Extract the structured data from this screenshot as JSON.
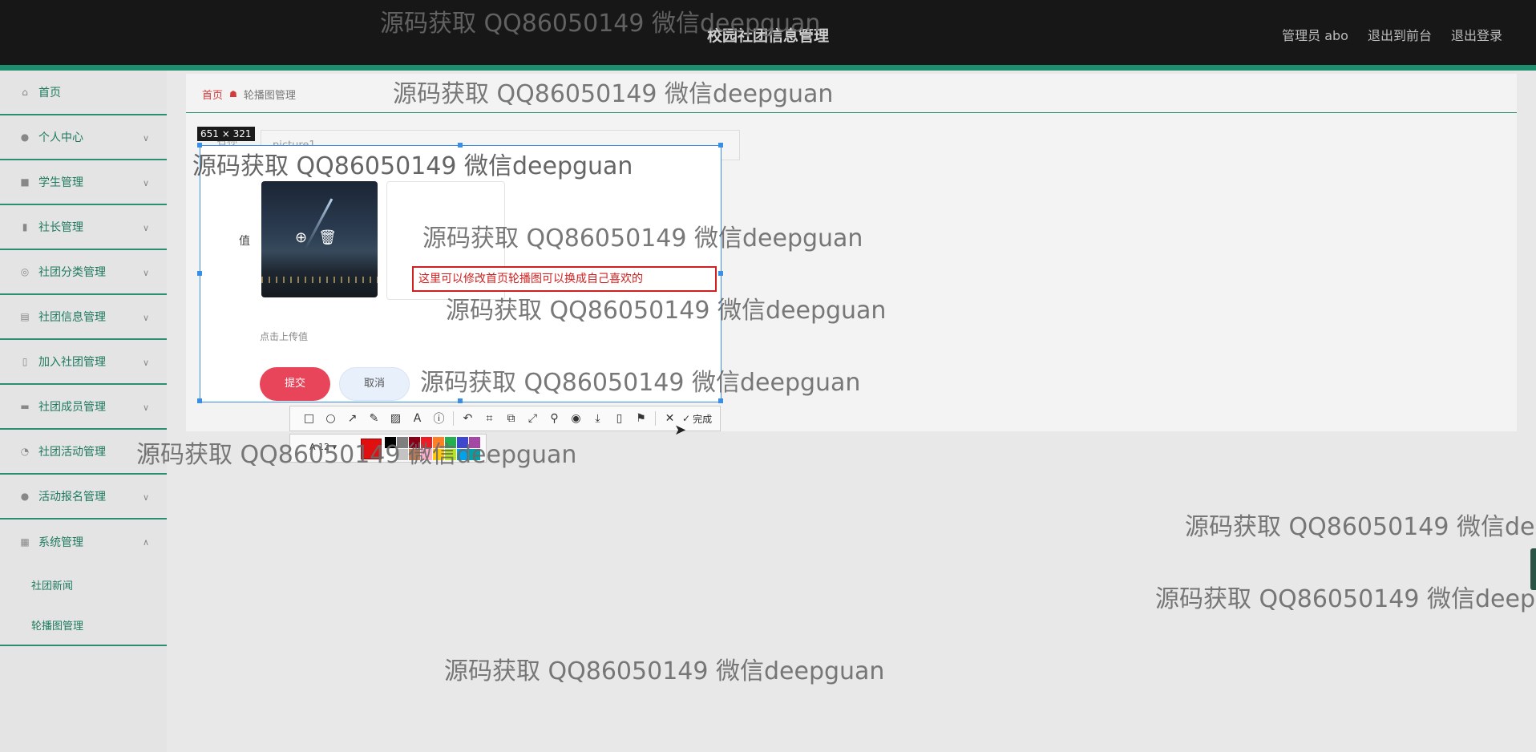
{
  "header": {
    "title": "校园社团信息管理",
    "links": [
      "管理员 abo",
      "退出到前台",
      "退出登录"
    ]
  },
  "sidebar": {
    "items": [
      {
        "label": "首页",
        "icon": "home-icon",
        "expandable": false
      },
      {
        "label": "个人中心",
        "icon": "user-icon",
        "expandable": true
      },
      {
        "label": "学生管理",
        "icon": "briefcase-icon",
        "expandable": true
      },
      {
        "label": "社长管理",
        "icon": "microphone-icon",
        "expandable": true
      },
      {
        "label": "社团分类管理",
        "icon": "target-icon",
        "expandable": true
      },
      {
        "label": "社团信息管理",
        "icon": "clipboard-icon",
        "expandable": true
      },
      {
        "label": "加入社团管理",
        "icon": "phone-icon",
        "expandable": true
      },
      {
        "label": "社团成员管理",
        "icon": "chat-icon",
        "expandable": true
      },
      {
        "label": "社团活动管理",
        "icon": "gauge-icon",
        "expandable": true
      },
      {
        "label": "活动报名管理",
        "icon": "leaf-icon",
        "expandable": true
      },
      {
        "label": "系统管理",
        "icon": "chart-icon",
        "expandable": true,
        "expanded": true
      }
    ],
    "sub_items": [
      "社团新闻",
      "轮播图管理"
    ]
  },
  "breadcrumb": {
    "home": "首页",
    "current": "轮播图管理"
  },
  "form": {
    "name_label": "名称",
    "name_value": "picture1",
    "value_label": "值",
    "upload_hint": "点击上传值",
    "submit": "提交",
    "cancel": "取消"
  },
  "annotation": {
    "tip": "这里可以修改首页轮播图可以换成自己喜欢的"
  },
  "capture": {
    "size": "651 × 321",
    "font_size": "12",
    "done": "完成",
    "selected_color": "#e01010",
    "palette": [
      "#000000",
      "#7f7f7f",
      "#880015",
      "#ed1c24",
      "#ff7f27",
      "#22b14c",
      "#3f48cc",
      "#a349a4",
      "#ffffff",
      "#c3c3c3",
      "#b97a57",
      "#ffaec9",
      "#ffc90e",
      "#b5e61d",
      "#00a2e8",
      "#00a2a8"
    ]
  },
  "watermark": "源码获取 QQ86050149 微信deepguan"
}
